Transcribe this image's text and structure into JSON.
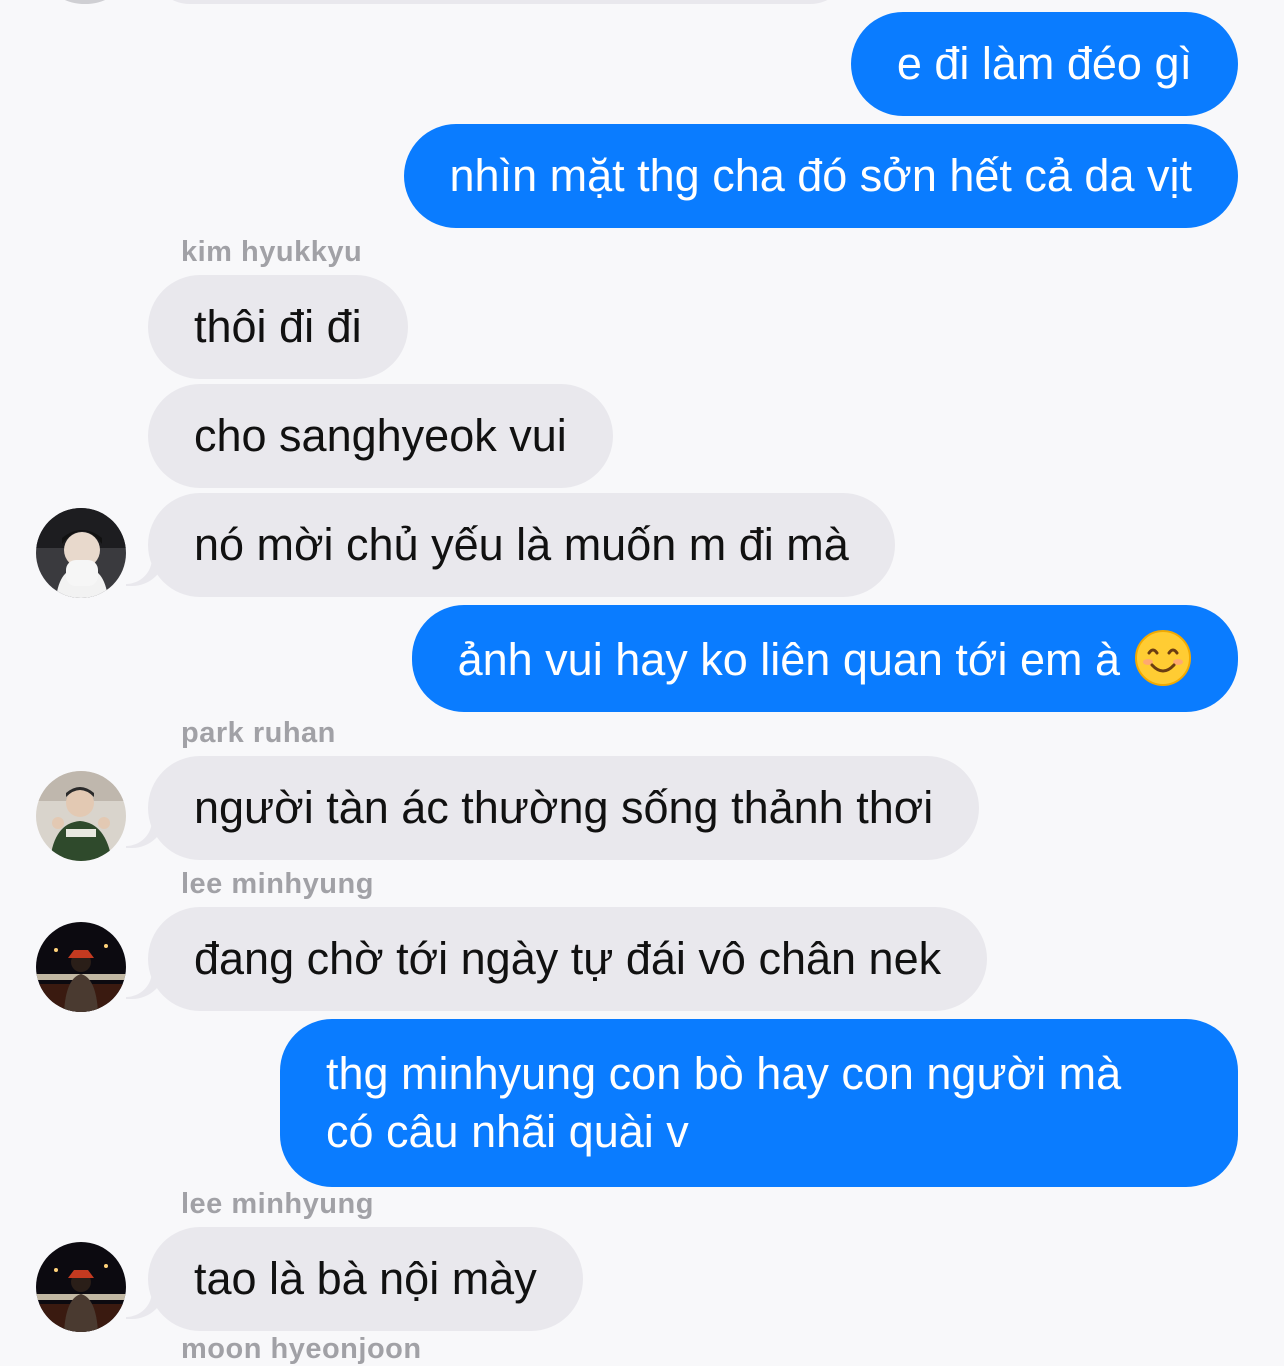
{
  "messages": [
    {
      "type": "outgoing",
      "text": "e đi làm đéo gì"
    },
    {
      "type": "outgoing",
      "text": "nhìn mặt thg cha đó sởn hết cả da vịt"
    },
    {
      "type": "incoming",
      "sender": "kim hyukkyu",
      "text": "thôi đi đi"
    },
    {
      "type": "incoming",
      "text": "cho sanghyeok vui"
    },
    {
      "type": "incoming",
      "text": "nó mời chủ yếu là muốn m đi mà"
    },
    {
      "type": "outgoing",
      "text": "ảnh vui hay ko liên quan tới em à",
      "emoji": "smiling-face"
    },
    {
      "type": "incoming",
      "sender": "park ruhan",
      "text": "người tàn ác thường sống thảnh thơi"
    },
    {
      "type": "incoming",
      "sender": "lee minhyung",
      "text": "đang chờ tới ngày tự đái vô chân nek"
    },
    {
      "type": "outgoing",
      "text": "thg minhyung con bò hay con người mà có câu nhãi quài v"
    },
    {
      "type": "incoming",
      "sender": "lee minhyung",
      "text": "tao là bà nội mày"
    },
    {
      "type": "incoming",
      "sender": "moon hyeonjoon",
      "text": ""
    }
  ],
  "colors": {
    "outgoing_bubble": "#0a7cff",
    "incoming_bubble": "#e9e8ed",
    "background": "#f8f8fa",
    "sender_name": "#a1a1a6"
  }
}
